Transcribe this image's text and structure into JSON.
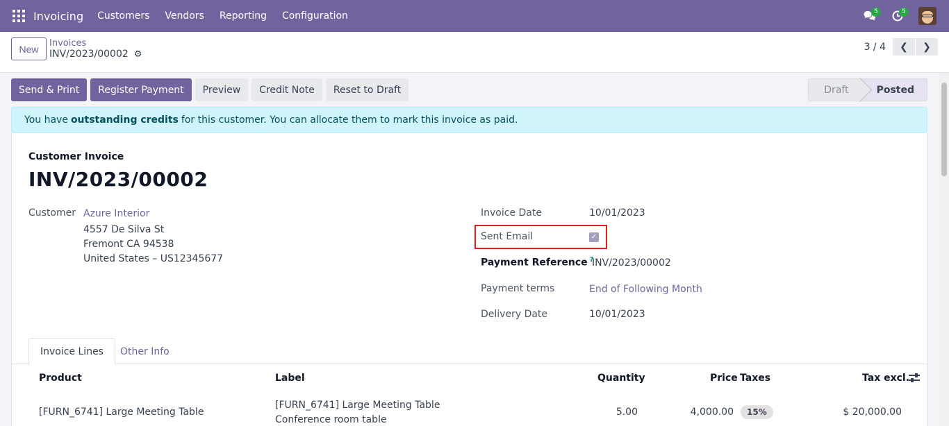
{
  "navbar": {
    "app_name": "Invoicing",
    "menu": [
      "Customers",
      "Vendors",
      "Reporting",
      "Configuration"
    ],
    "messages_count": "5",
    "activities_count": "5",
    "accent_color": "#71639e"
  },
  "control": {
    "new_label": "New",
    "breadcrumb_parent": "Invoices",
    "breadcrumb_current": "INV/2023/00002",
    "pager_value": "3 / 4"
  },
  "actions": {
    "send_print": "Send & Print",
    "register_payment": "Register Payment",
    "preview": "Preview",
    "credit_note": "Credit Note",
    "reset_to_draft": "Reset to Draft"
  },
  "stages": {
    "draft": "Draft",
    "posted": "Posted",
    "current": "Posted"
  },
  "alert": {
    "prefix": "You have",
    "emphasis": "outstanding credits",
    "suffix": "for this customer. You can allocate them to mark this invoice as paid."
  },
  "invoice": {
    "type": "Customer Invoice",
    "number": "INV/2023/00002",
    "customer_label": "Customer",
    "customer_name": "Azure Interior",
    "address_line1": "4557 De Silva St",
    "address_line2": "Fremont CA 94538",
    "address_line3": "United States – US12345677",
    "invoice_date_label": "Invoice Date",
    "invoice_date": "10/01/2023",
    "sent_email_label": "Sent Email",
    "sent_email_checked": true,
    "payment_reference_label": "Payment Reference",
    "payment_reference_help": "?",
    "payment_reference": "INV/2023/00002",
    "payment_terms_label": "Payment terms",
    "payment_terms": "End of Following Month",
    "delivery_date_label": "Delivery Date",
    "delivery_date": "10/01/2023"
  },
  "tabs": [
    "Invoice Lines",
    "Other Info"
  ],
  "lines": {
    "columns": [
      "Product",
      "Label",
      "Quantity",
      "Price",
      "Taxes",
      "Tax excl."
    ],
    "rows": [
      {
        "product": "[FURN_6741] Large Meeting Table",
        "label_line1": "[FURN_6741] Large Meeting Table",
        "label_line2": "Conference room table",
        "quantity": "5.00",
        "price": "4,000.00",
        "taxes": "15%",
        "tax_excl": "$ 20,000.00"
      }
    ]
  }
}
